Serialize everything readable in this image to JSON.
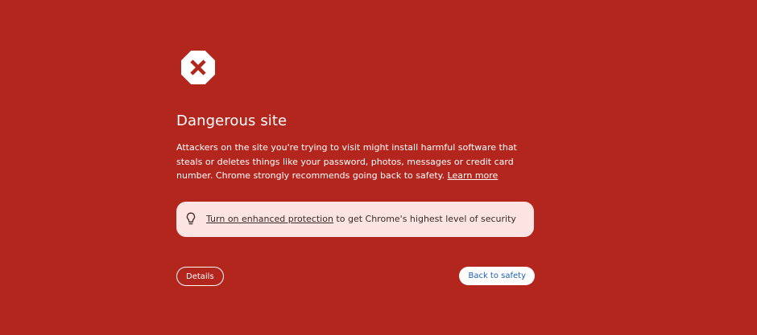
{
  "icons": {
    "danger": "octagon-x-icon",
    "tip": "lightbulb-icon"
  },
  "colors": {
    "background": "#b3261e",
    "tip_background": "#fbe4e2",
    "primary_button_text": "#1a5fb4"
  },
  "heading": {
    "title": "Dangerous site"
  },
  "message": {
    "text": "Attackers on the site you're trying to visit might install harmful software that steals or deletes things like your password, photos, messages or credit card number. Chrome strongly recommends going back to safety.",
    "learn_more": "Learn more"
  },
  "tip": {
    "link": "Turn on enhanced protection",
    "text": " to get Chrome's highest level of security"
  },
  "buttons": {
    "details": "Details",
    "back_to_safety": "Back to safety"
  }
}
